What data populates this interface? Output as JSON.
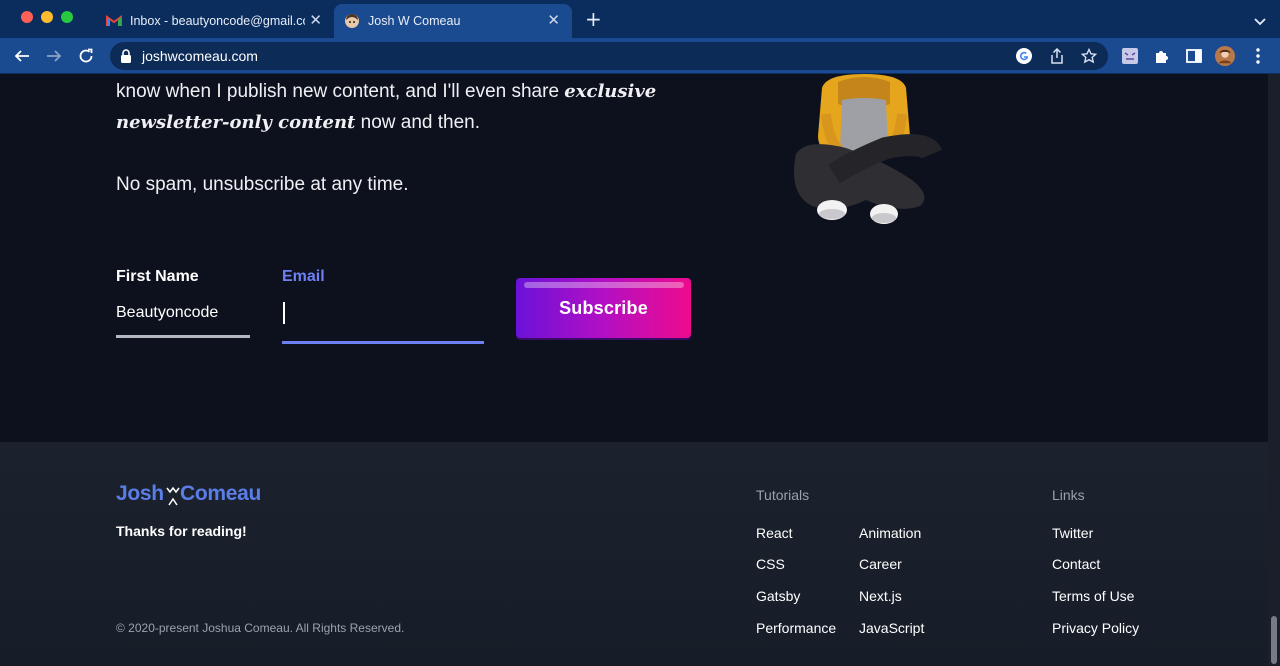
{
  "browser": {
    "tabs": [
      {
        "title": "Inbox - beautyoncode@gmail.com",
        "favicon": "gmail-icon",
        "active": false
      },
      {
        "title": "Josh W Comeau",
        "favicon": "avatar-favicon",
        "active": true
      }
    ],
    "url": "joshwcomeau.com",
    "colors": {
      "tabbar": "#0a2d5e",
      "toolbar": "#1a4a8f"
    }
  },
  "newsletter": {
    "paragraph_lead": "know when I publish new content, and I'll even share",
    "emphasis_1": "exclusive",
    "emphasis_2": "newsletter-only content",
    "paragraph_tail": "now and then.",
    "no_spam": "No spam, unsubscribe at any time.",
    "first_name_label": "First Name",
    "first_name_value": "Beautyoncode",
    "email_label": "Email",
    "email_value": "",
    "subscribe_label": "Subscribe",
    "colors": {
      "accent": "#6f7ff5",
      "button_start": "#6a12d9",
      "button_end": "#ee0b8c"
    }
  },
  "footer": {
    "logo_first": "Josh",
    "logo_middle": "W",
    "logo_last": "Comeau",
    "thanks": "Thanks for reading!",
    "copyright": "© 2020-present Joshua Comeau. All Rights Reserved.",
    "tutorials_heading": "Tutorials",
    "tutorials": [
      "React",
      "Animation",
      "CSS",
      "Career",
      "Gatsby",
      "Next.js",
      "Performance",
      "JavaScript"
    ],
    "links_heading": "Links",
    "links": [
      "Twitter",
      "Contact",
      "Terms of Use",
      "Privacy Policy"
    ]
  }
}
